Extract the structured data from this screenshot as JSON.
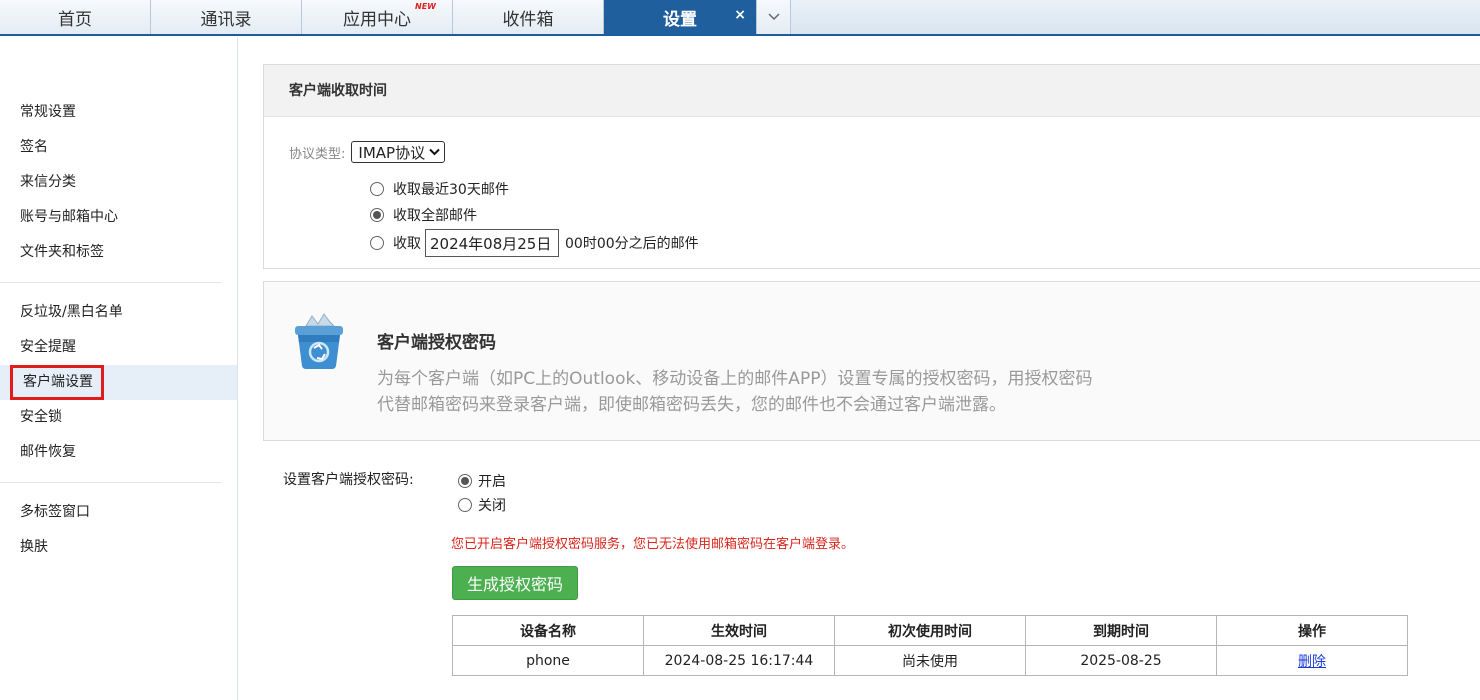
{
  "tabs": [
    {
      "label": "首页"
    },
    {
      "label": "通讯录"
    },
    {
      "label": "应用中心",
      "badge": "NEW"
    },
    {
      "label": "收件箱"
    },
    {
      "label": "设置",
      "close": "×"
    }
  ],
  "tab_more_icon": "chevron-down-icon",
  "sidebar": {
    "group1": [
      "常规设置",
      "签名",
      "来信分类",
      "账号与邮箱中心",
      "文件夹和标签"
    ],
    "group2": [
      "反垃圾/黑白名单",
      "安全提醒",
      "客户端设置",
      "安全锁",
      "邮件恢复"
    ],
    "group3": [
      "多标签窗口",
      "换肤"
    ],
    "active": "客户端设置"
  },
  "fetch_section": {
    "title": "客户端收取时间",
    "protocol_label": "协议类型:",
    "protocol_value": "IMAP协议",
    "options": [
      "收取最近30天邮件",
      "收取全部邮件"
    ],
    "selected_option": 1,
    "custom_prefix": "收取",
    "custom_date": "2024年08月25日",
    "custom_suffix": "00时00分之后的邮件"
  },
  "auth_section": {
    "icon": "recycle-bin-icon",
    "title": "客户端授权密码",
    "desc": "为每个客户端（如PC上的Outlook、移动设备上的邮件APP）设置专属的授权密码，用授权密码代替邮箱密码来登录客户端，即使邮箱密码丢失，您的邮件也不会通过客户端泄露。",
    "set_label": "设置客户端授权密码:",
    "on_label": "开启",
    "off_label": "关闭",
    "warning": "您已开启客户端授权密码服务，您已无法使用邮箱密码在客户端登录。",
    "generate_button": "生成授权密码",
    "colors": {
      "warning": "#d9261c",
      "button": "#4caf50",
      "tab_active": "#1f5f9e"
    }
  },
  "devices_table": {
    "headers": [
      "设备名称",
      "生效时间",
      "初次使用时间",
      "到期时间",
      "操作"
    ],
    "rows": [
      {
        "name": "phone",
        "effective": "2024-08-25 16:17:44",
        "first_use": "尚未使用",
        "expires": "2025-08-25",
        "action": "删除"
      }
    ]
  }
}
